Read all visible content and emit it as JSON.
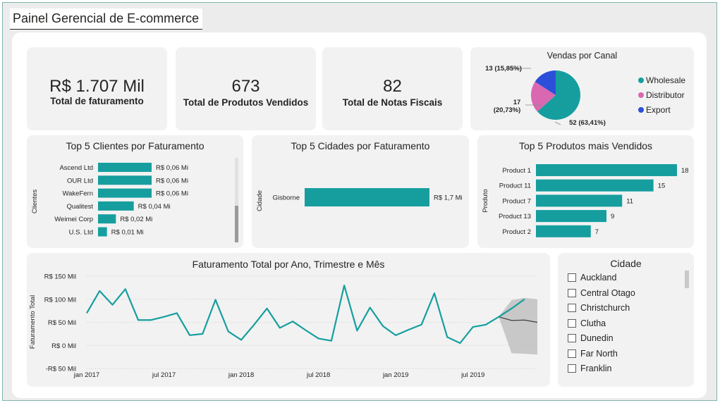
{
  "page_title": "Painel Gerencial de E-commerce",
  "colors": {
    "teal": "#169e9f",
    "pink": "#d968b1",
    "blue": "#2c4fd9",
    "card": "#f2f2f2",
    "forecast_band": "#bdbdbd"
  },
  "kpis": [
    {
      "value": "R$ 1.707 Mil",
      "label": "Total de faturamento"
    },
    {
      "value": "673",
      "label": "Total de Produtos Vendidos"
    },
    {
      "value": "82",
      "label": "Total de Notas Fiscais"
    }
  ],
  "sales_by_channel": {
    "title": "Vendas por Canal",
    "chart_data": {
      "type": "pie",
      "categories": [
        "Wholesale",
        "Distributor",
        "Export"
      ],
      "values": [
        52,
        17,
        13
      ],
      "data_labels": [
        "52 (63,41%)",
        "17",
        "(20,73%)",
        "13 (15,85%)"
      ],
      "legend_placement": "right"
    },
    "legend": [
      "Wholesale",
      "Distributor",
      "Export"
    ]
  },
  "top_clients": {
    "title": "Top 5 Clientes por Faturamento",
    "axis_title": "Clientes",
    "chart_data": {
      "type": "bar",
      "categories": [
        "Ascend Ltd",
        "OUR Ltd",
        "WakeFern",
        "Qualitest",
        "Weimei Corp",
        "U.S. Ltd"
      ],
      "values": [
        0.06,
        0.06,
        0.06,
        0.04,
        0.02,
        0.01
      ],
      "data_labels": [
        "R$ 0,06 Mi",
        "R$ 0,06 Mi",
        "R$ 0,06 Mi",
        "R$ 0,04 Mi",
        "R$ 0,02 Mi",
        "R$ 0,01 Mi"
      ]
    }
  },
  "top_cities": {
    "title": "Top 5 Cidades por Faturamento",
    "axis_title": "Cidade",
    "chart_data": {
      "type": "bar",
      "categories": [
        "Gisborne"
      ],
      "values": [
        1.7
      ],
      "data_labels": [
        "R$ 1,7 Mi"
      ]
    }
  },
  "top_products": {
    "title": "Top 5 Produtos mais Vendidos",
    "axis_title": "Produto",
    "chart_data": {
      "type": "bar",
      "categories": [
        "Product 1",
        "Product 11",
        "Product 7",
        "Product 13",
        "Product 2"
      ],
      "values": [
        18,
        15,
        11,
        9,
        7
      ],
      "data_labels": [
        "18",
        "15",
        "11",
        "9",
        "7"
      ]
    }
  },
  "revenue_trend": {
    "title": "Faturamento Total por Ano, Trimestre e Mês",
    "chart_data": {
      "type": "line",
      "ylabel": "Faturamento Total",
      "ylim": [
        -50,
        150
      ],
      "y_ticks": [
        "R$ 150 Mil",
        "R$ 100 Mil",
        "R$ 50 Mil",
        "R$ 0 Mil",
        "-R$ 50 Mil"
      ],
      "x_ticks": [
        "jan 2017",
        "jul 2017",
        "jan 2018",
        "jul 2018",
        "jan 2019",
        "jul 2019"
      ],
      "grid": true,
      "x": [
        "2017-01",
        "2017-02",
        "2017-03",
        "2017-04",
        "2017-05",
        "2017-06",
        "2017-07",
        "2017-08",
        "2017-09",
        "2017-10",
        "2017-11",
        "2017-12",
        "2018-01",
        "2018-02",
        "2018-03",
        "2018-04",
        "2018-05",
        "2018-06",
        "2018-07",
        "2018-08",
        "2018-09",
        "2018-10",
        "2018-11",
        "2018-12",
        "2019-01",
        "2019-02",
        "2019-03",
        "2019-04",
        "2019-05",
        "2019-06",
        "2019-07",
        "2019-08",
        "2019-09",
        "2019-10",
        "2019-11"
      ],
      "series": [
        {
          "values": [
            70,
            118,
            88,
            122,
            55,
            55,
            62,
            70,
            22,
            25,
            99,
            30,
            12,
            45,
            80,
            38,
            52,
            33,
            15,
            10,
            130,
            32,
            82,
            42,
            22,
            34,
            45,
            113,
            18,
            5,
            40,
            45,
            62,
            80,
            100
          ]
        }
      ],
      "forecast": {
        "x": [
          "2019-09",
          "2019-10",
          "2019-11",
          "2019-12"
        ],
        "values": [
          62,
          54,
          55,
          50
        ],
        "upper": [
          62,
          98,
          103,
          100
        ],
        "lower": [
          62,
          -17,
          -18,
          -20
        ]
      }
    }
  },
  "city_slicer": {
    "title": "Cidade",
    "items": [
      "Auckland",
      "Central Otago",
      "Christchurch",
      "Clutha",
      "Dunedin",
      "Far North",
      "Franklin"
    ]
  }
}
